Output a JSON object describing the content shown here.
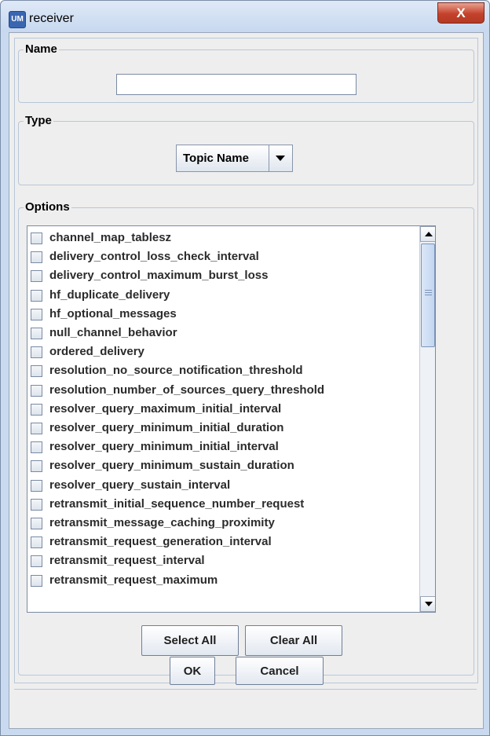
{
  "window": {
    "title": "receiver",
    "app_icon": "UM",
    "close_glyph": "X"
  },
  "name_group": {
    "label": "Name",
    "value": ""
  },
  "type_group": {
    "label": "Type",
    "selected": "Topic Name"
  },
  "options_group": {
    "label": "Options",
    "items": [
      "channel_map_tablesz",
      "delivery_control_loss_check_interval",
      "delivery_control_maximum_burst_loss",
      "hf_duplicate_delivery",
      "hf_optional_messages",
      "null_channel_behavior",
      "ordered_delivery",
      "resolution_no_source_notification_threshold",
      "resolution_number_of_sources_query_threshold",
      "resolver_query_maximum_initial_interval",
      "resolver_query_minimum_initial_duration",
      "resolver_query_minimum_initial_interval",
      "resolver_query_minimum_sustain_duration",
      "resolver_query_sustain_interval",
      "retransmit_initial_sequence_number_request",
      "retransmit_message_caching_proximity",
      "retransmit_request_generation_interval",
      "retransmit_request_interval",
      "retransmit_request_maximum"
    ],
    "select_all_label": "Select All",
    "clear_all_label": "Clear All"
  },
  "footer": {
    "ok_label": "OK",
    "cancel_label": "Cancel"
  }
}
